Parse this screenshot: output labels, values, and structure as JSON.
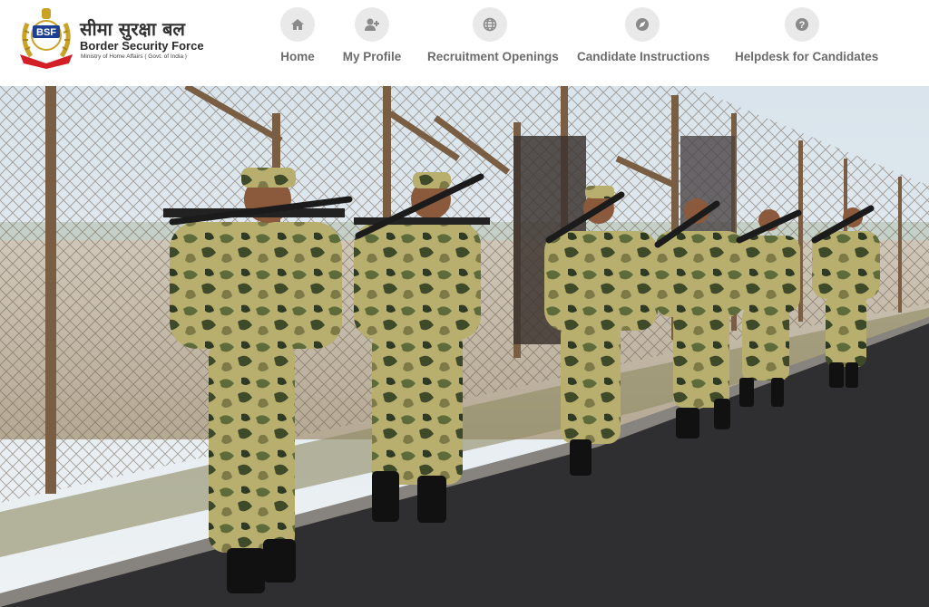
{
  "brand": {
    "badge": "BSF",
    "name_hindi": "सीमा सुरक्षा बल",
    "name": "Border Security Force",
    "ministry": "Ministry of Home Affairs ( Govt. of India )"
  },
  "nav": {
    "items": [
      {
        "label": "Home",
        "icon": "home-icon"
      },
      {
        "label": "My Profile",
        "icon": "user-plus-icon"
      },
      {
        "label": "Recruitment Openings",
        "icon": "globe-icon"
      },
      {
        "label": "Candidate Instructions",
        "icon": "compass-icon"
      },
      {
        "label": "Helpdesk for Candidates",
        "icon": "question-icon"
      }
    ]
  },
  "colors": {
    "nav_circle": "#e9e9e9",
    "nav_text": "#6b6b6b",
    "brand_red": "#d32027",
    "brand_gold": "#c9a227",
    "brand_blue": "#1c3f94"
  }
}
